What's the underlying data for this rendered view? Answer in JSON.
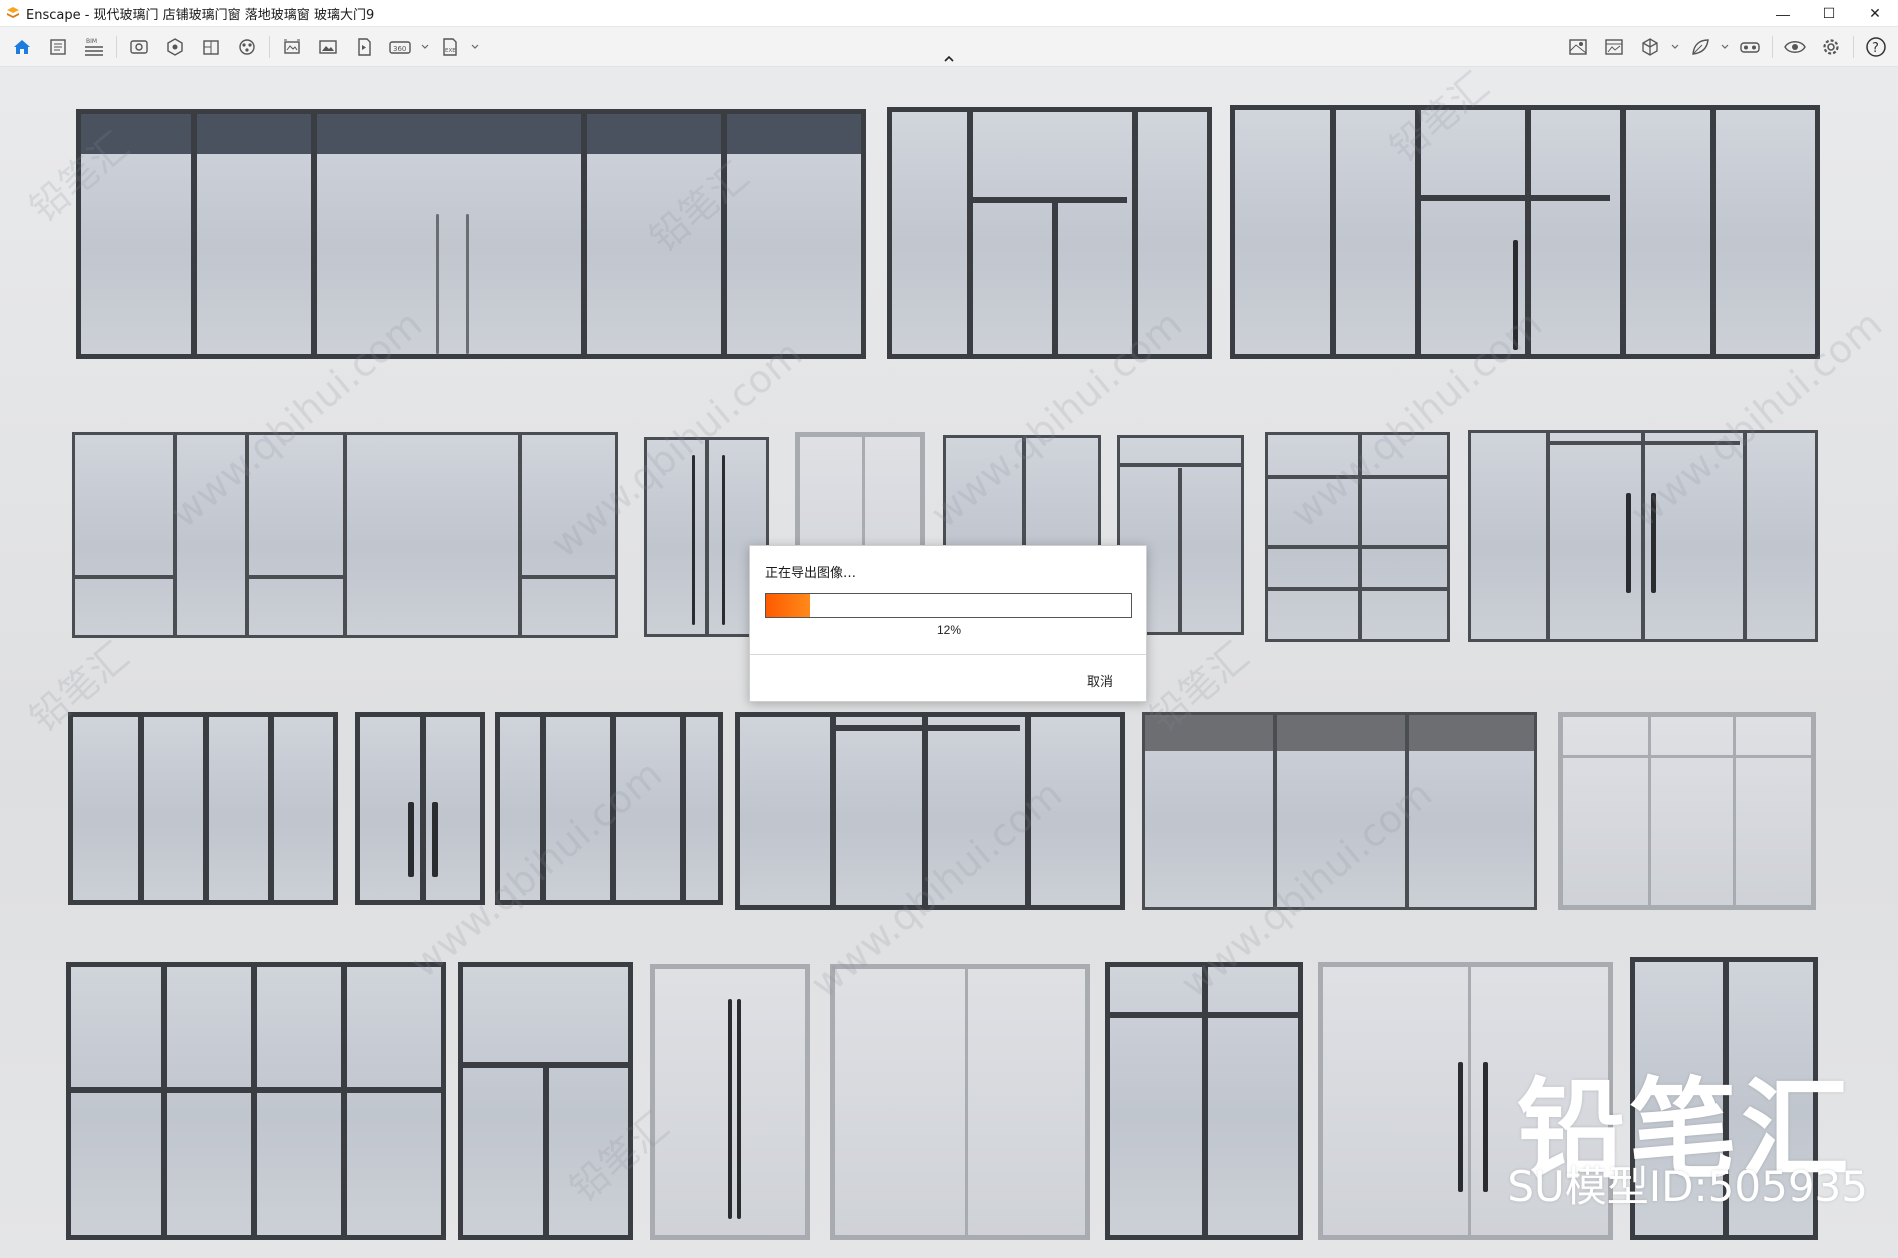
{
  "window": {
    "title": "Enscape - 现代玻璃门 店铺玻璃门窗 落地玻璃窗 玻璃大门9",
    "minimize_label": "—",
    "maximize_label": "☐",
    "close_label": "✕"
  },
  "toolbar": {
    "left_icons": [
      "home-icon",
      "document-icon",
      "bim-icon",
      "view-icon",
      "asset-library-icon",
      "material-editor-icon",
      "atmosphere-icon",
      "batch-render-icon",
      "screenshot-icon",
      "panorama-icon",
      "render-360-icon",
      "export-exe-icon"
    ],
    "right_icons": [
      "map-icon",
      "image-icon",
      "cube-icon",
      "leaf-icon",
      "vr-headset-icon",
      "eye-icon",
      "settings-icon",
      "help-icon"
    ],
    "bim_label": "BIM",
    "pano_label": "360",
    "exe_label": "EXE",
    "help_label": "?"
  },
  "dialog": {
    "title": "正在导出图像…",
    "progress_percent": 12,
    "progress_text": "12%",
    "cancel_label": "取消"
  },
  "overlay": {
    "brand": "铅笔汇",
    "model_id": "SU模型ID:505935",
    "watermark_text": "www.qbihui.com",
    "watermark_brand": "铅笔汇"
  },
  "colors": {
    "accent": "#1c7ce0",
    "progress": "#ff6a00",
    "frame": "#3a3d42"
  }
}
